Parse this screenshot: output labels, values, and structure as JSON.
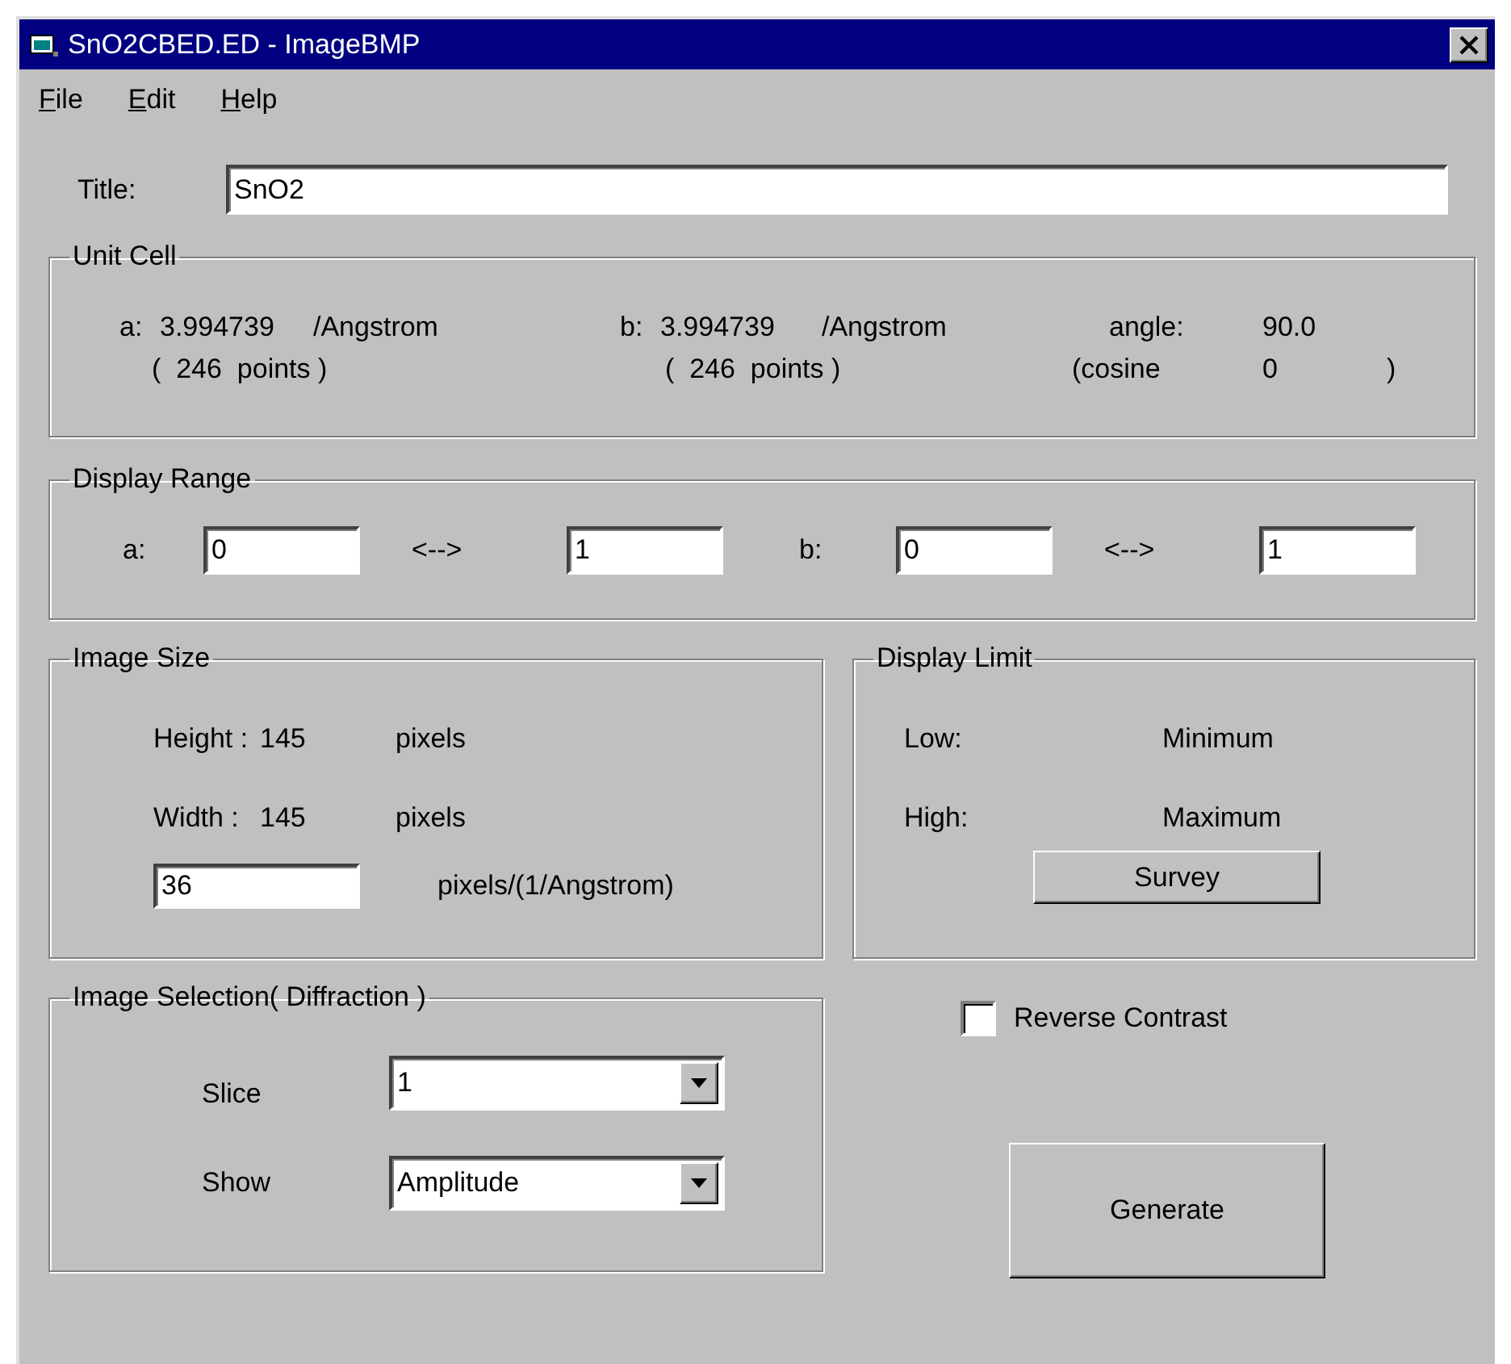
{
  "window": {
    "title": "SnO2CBED.ED - ImageBMP"
  },
  "menu": [
    {
      "label": "File"
    },
    {
      "label": "Edit"
    },
    {
      "label": "Help"
    }
  ],
  "title_field": {
    "label": "Title:",
    "value": "SnO2"
  },
  "unit_cell": {
    "title": "Unit Cell",
    "row_1": [
      "a:",
      "3.994739",
      "/Angstrom",
      "b:",
      "3.994739",
      "/Angstrom",
      "angle:",
      "90.0"
    ],
    "row_2": [
      "(  246  points )",
      "(  246  points )",
      "(cosine",
      "0",
      ")"
    ]
  },
  "display_range": {
    "title": "Display Range",
    "a_label": "a:",
    "a_from": "0",
    "a_arrow": "<-->",
    "a_to": "1",
    "b_label": "b:",
    "b_from": "0",
    "b_arrow": "<-->",
    "b_to": "1"
  },
  "image_size": {
    "title": "Image Size",
    "height_label": "Height :",
    "height_value": "145",
    "height_unit": "pixels",
    "width_label": "Width :",
    "width_value": "145",
    "width_unit": "pixels",
    "scale_value": "36",
    "scale_unit": "pixels/(1/Angstrom)"
  },
  "display_limit": {
    "title": "Display Limit",
    "low_label": "Low:",
    "low_value": "Minimum",
    "high_label": "High:",
    "high_value": "Maximum",
    "button": "Survey"
  },
  "image_selection": {
    "title": "Image Selection( Diffraction )",
    "slice_label": "Slice",
    "slice_value": "1",
    "show_label": "Show",
    "show_value": "Amplitude"
  },
  "reverse_contrast": {
    "label": "Reverse Contrast",
    "checked": false
  },
  "generate_button": "Generate"
}
